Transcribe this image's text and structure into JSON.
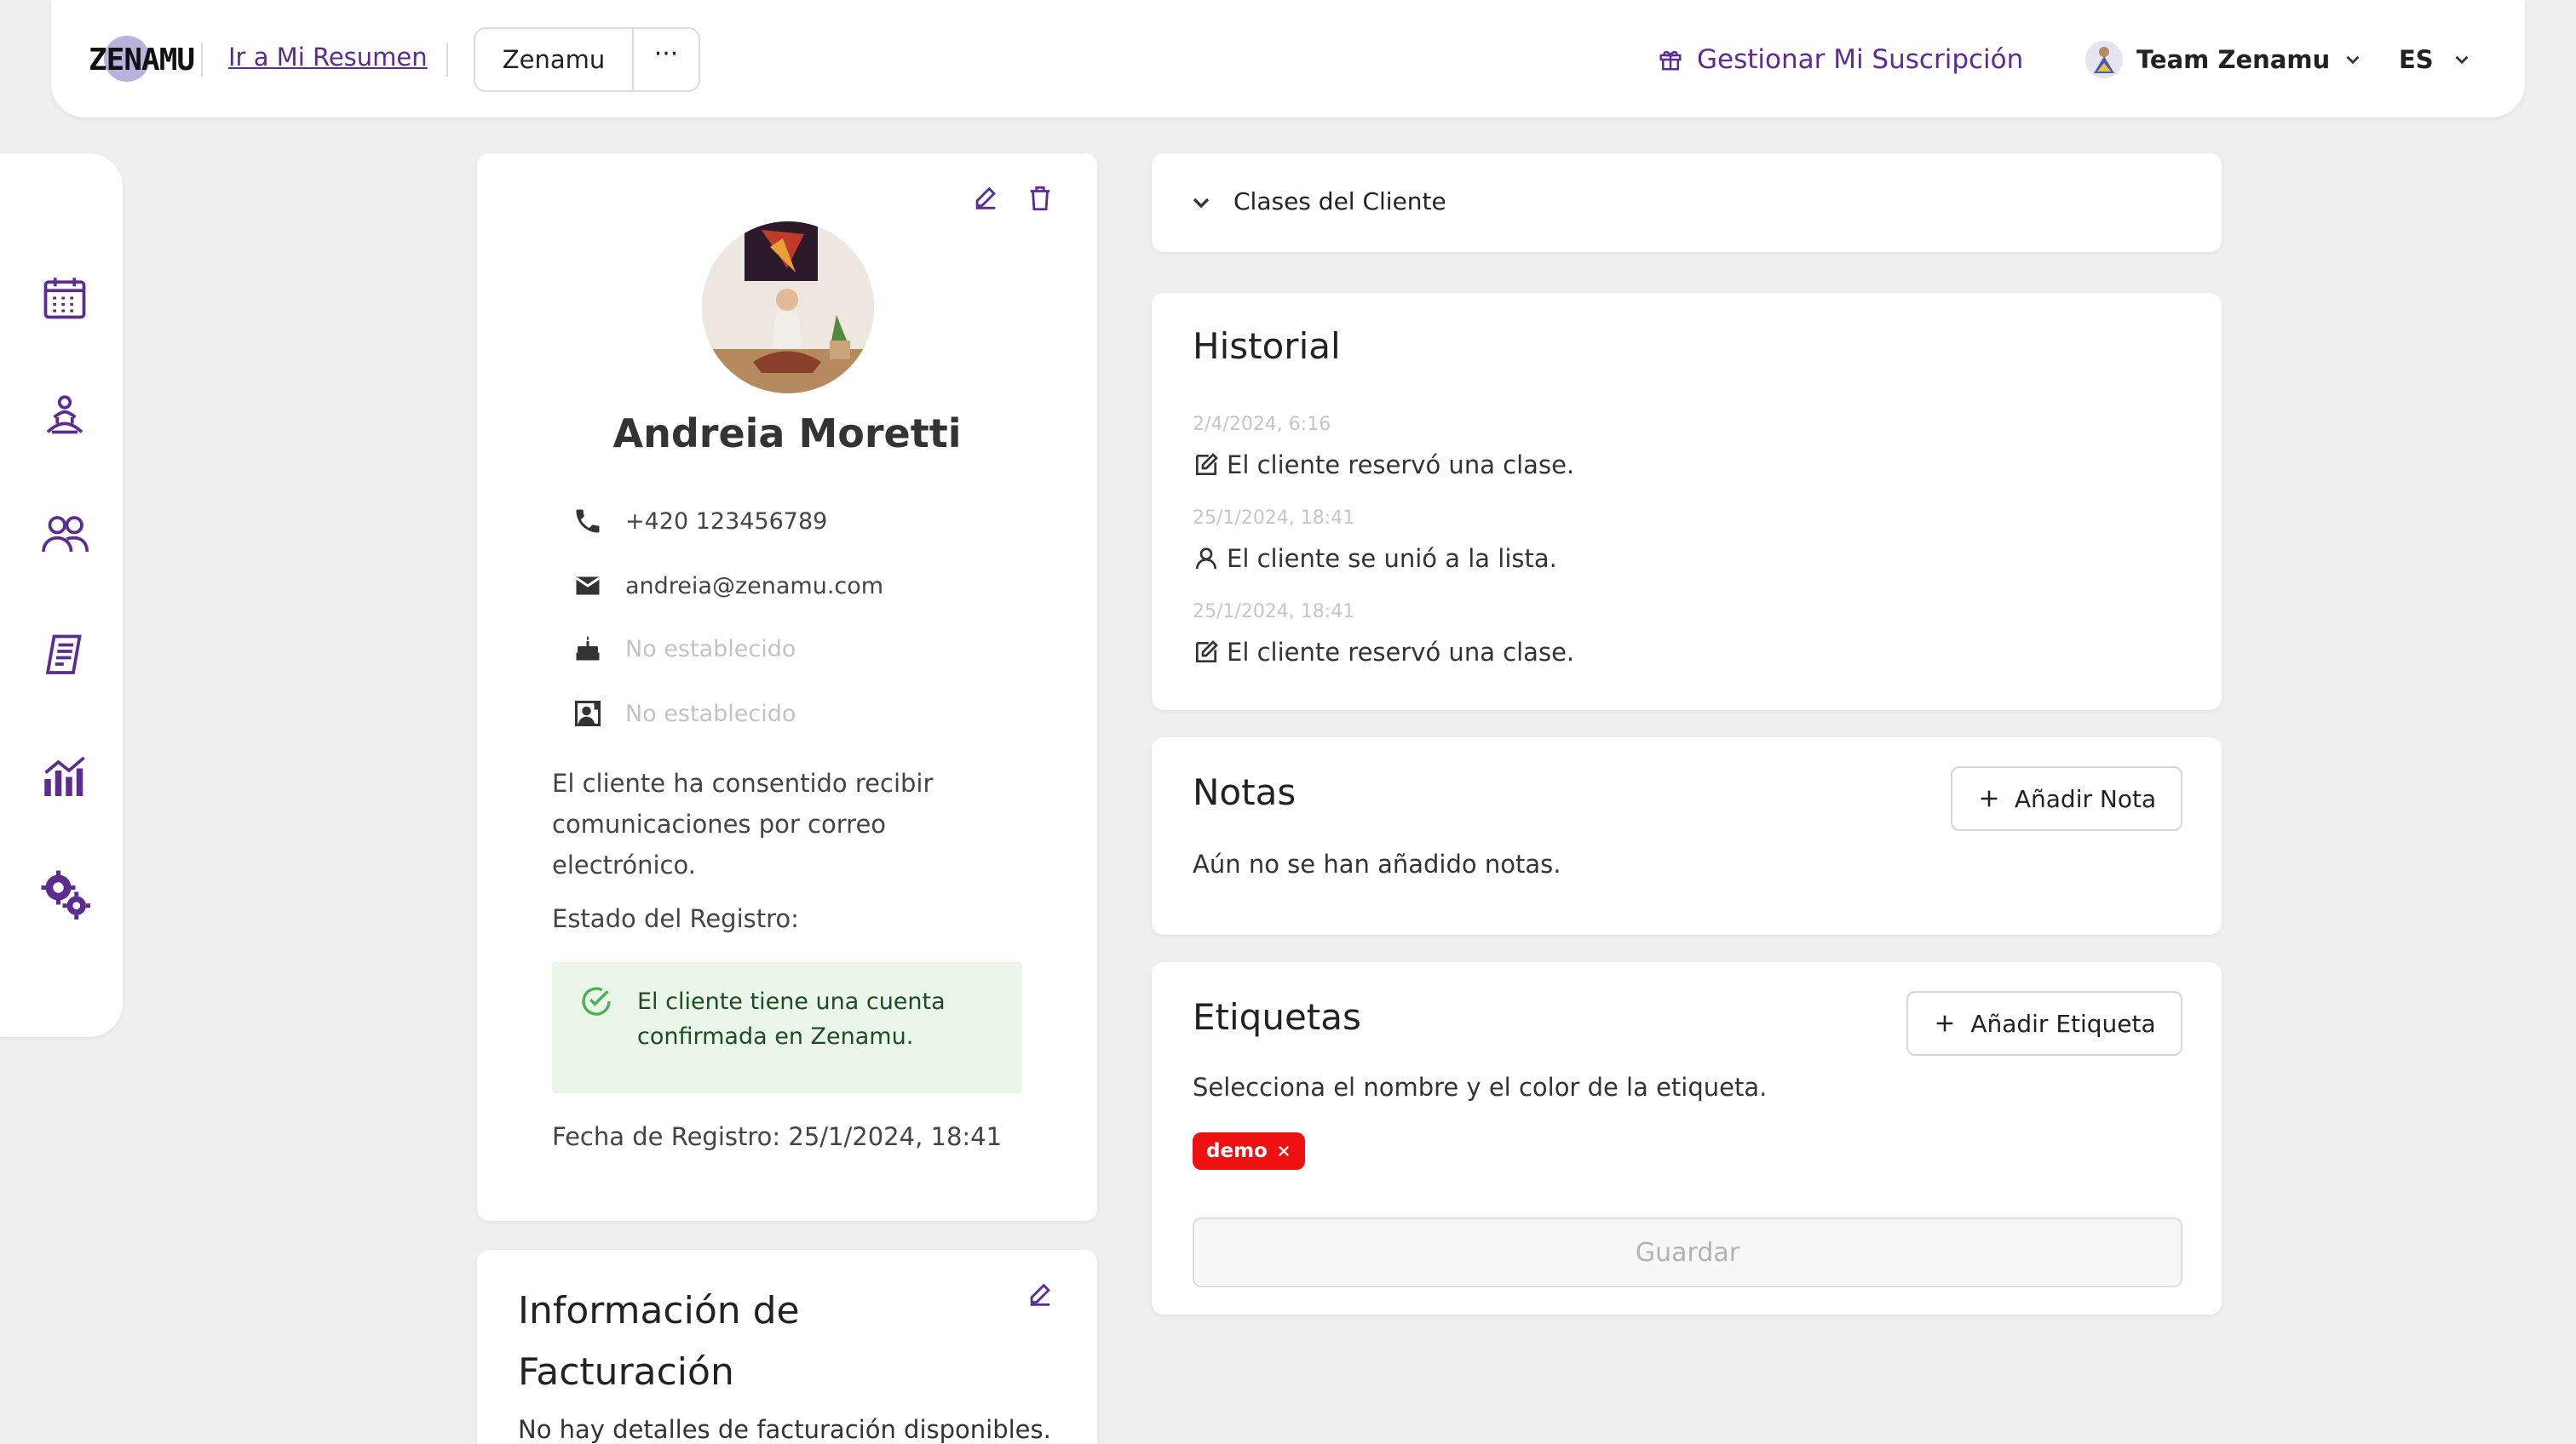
{
  "header": {
    "logo_text": "ZENAMU",
    "link_resumen": "Ir a Mi Resumen",
    "studio_name": "Zenamu",
    "more_label": "···",
    "subscription_label": "Gestionar Mi Suscripción",
    "team_name": "Team Zenamu",
    "language": "ES"
  },
  "sidebar": {
    "items": [
      {
        "icon": "calendar-icon"
      },
      {
        "icon": "meditation-icon"
      },
      {
        "icon": "users-icon"
      },
      {
        "icon": "receipt-icon"
      },
      {
        "icon": "stats-icon"
      },
      {
        "icon": "settings-icon"
      }
    ]
  },
  "profile": {
    "name": "Andreia Moretti",
    "phone": "+420 123456789",
    "email": "andreia@zenamu.com",
    "birthday": "No establecido",
    "id_field": "No establecido",
    "consent_text": "El cliente ha consentido recibir comunicaciones por correo electrónico.",
    "registration_label": "Estado del Registro:",
    "registration_status": "El cliente tiene una cuenta confirmada en Zenamu.",
    "registration_date": "Fecha de Registro: 25/1/2024, 18:41"
  },
  "billing": {
    "title": "Información de Facturación",
    "empty_text": "No hay detalles de facturación disponibles."
  },
  "clases": {
    "title": "Clases del Cliente"
  },
  "historial": {
    "title": "Historial",
    "entries": [
      {
        "time": "2/4/2024, 6:16",
        "text": "El cliente reservó una clase.",
        "icon": "edit-icon"
      },
      {
        "time": "25/1/2024, 18:41",
        "text": "El cliente se unió a la lista.",
        "icon": "user-icon"
      },
      {
        "time": "25/1/2024, 18:41",
        "text": "El cliente reservó una clase.",
        "icon": "edit-icon"
      }
    ]
  },
  "notas": {
    "title": "Notas",
    "add_label": "Añadir Nota",
    "empty_text": "Aún no se han añadido notas."
  },
  "etiquetas": {
    "title": "Etiquetas",
    "add_label": "Añadir Etiqueta",
    "description": "Selecciona el nombre y el color de la etiqueta.",
    "tags": [
      {
        "label": "demo",
        "color": "#ee1111"
      }
    ],
    "save_label": "Guardar"
  },
  "colors": {
    "accent": "#5b2d8f",
    "background": "#efefef",
    "success_bg": "#eaf6ea",
    "success_icon": "#4caf50",
    "tag_red": "#ee1111"
  }
}
